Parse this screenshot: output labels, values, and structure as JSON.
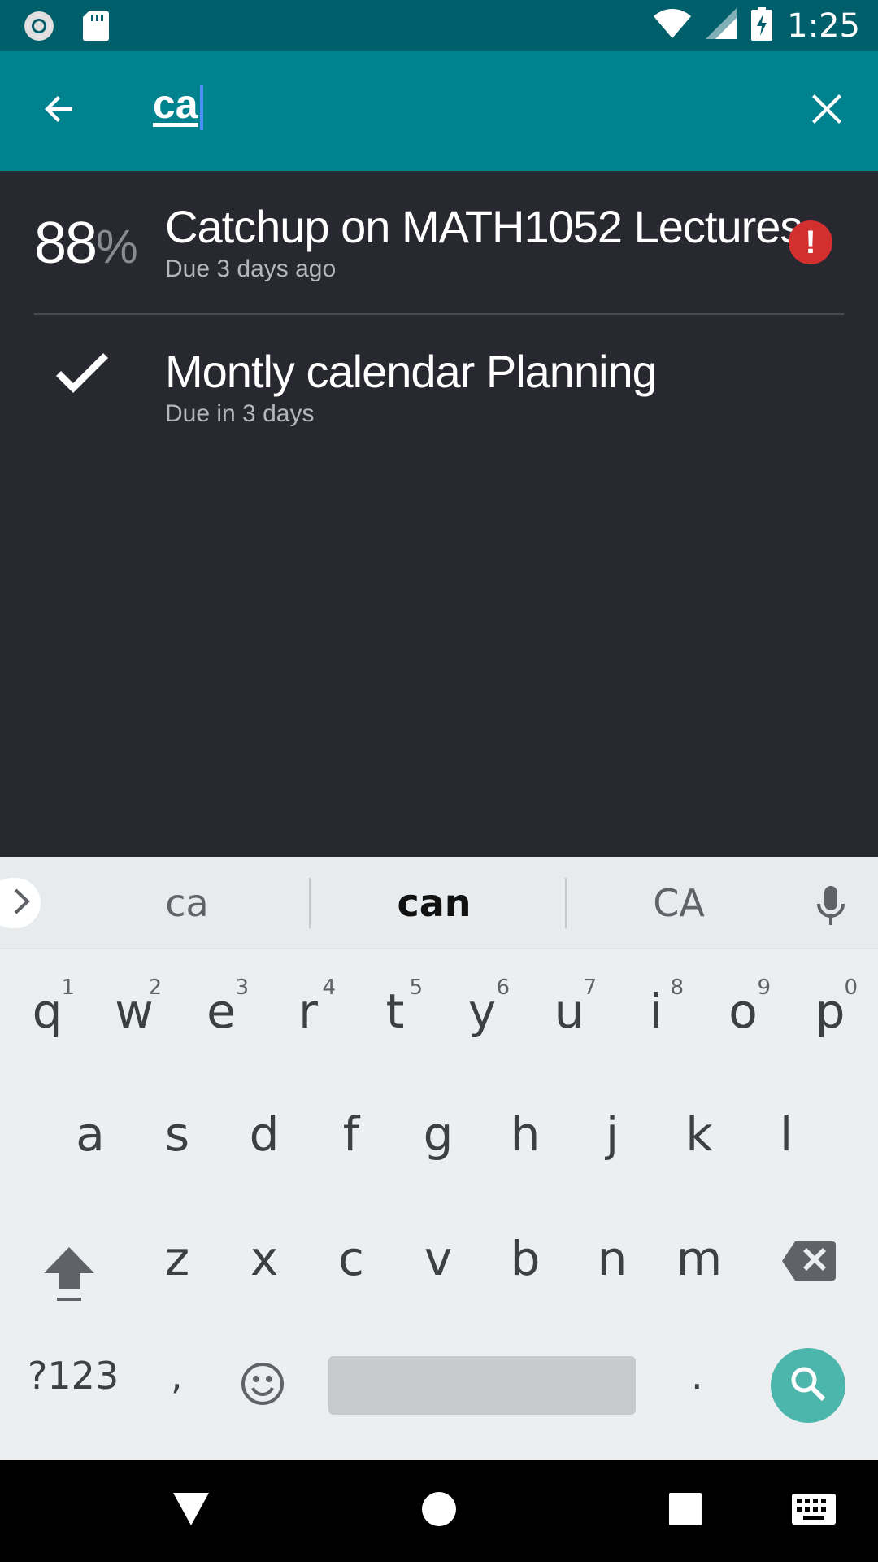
{
  "status_bar": {
    "time": "1:25",
    "icons": [
      "record-icon",
      "sd-card-icon",
      "wifi-icon",
      "cell-signal-icon",
      "battery-charging-icon"
    ]
  },
  "toolbar": {
    "search_query": "ca",
    "back_icon": "arrow-back-icon",
    "clear_icon": "close-icon"
  },
  "tasks": [
    {
      "progress_value": "88",
      "progress_unit": "%",
      "title": "Catchup on MATH1052 Lectures",
      "due": "Due 3 days ago",
      "status_icon": "overdue-alert-icon"
    },
    {
      "title": "Montly calendar Planning",
      "due": "Due in 3 days",
      "status_icon": "completed-check-icon"
    }
  ],
  "keyboard": {
    "suggestions": [
      "ca",
      "can",
      "CA"
    ],
    "row1": [
      {
        "key": "q",
        "hint": "1"
      },
      {
        "key": "w",
        "hint": "2"
      },
      {
        "key": "e",
        "hint": "3"
      },
      {
        "key": "r",
        "hint": "4"
      },
      {
        "key": "t",
        "hint": "5"
      },
      {
        "key": "y",
        "hint": "6"
      },
      {
        "key": "u",
        "hint": "7"
      },
      {
        "key": "i",
        "hint": "8"
      },
      {
        "key": "o",
        "hint": "9"
      },
      {
        "key": "p",
        "hint": "0"
      }
    ],
    "row2": [
      "a",
      "s",
      "d",
      "f",
      "g",
      "h",
      "j",
      "k",
      "l"
    ],
    "row3": [
      "z",
      "x",
      "c",
      "v",
      "b",
      "n",
      "m"
    ],
    "symbols_key": "?123",
    "comma_key": ",",
    "period_key": ".",
    "accent_color": "#4db6ac"
  },
  "nav_bar": {
    "icons": [
      "back-triangle-icon",
      "home-circle-icon",
      "recents-square-icon",
      "keyboard-icon"
    ]
  },
  "colors": {
    "toolbar": "#00838f",
    "status_bar": "#005f6a",
    "background": "#272830",
    "alert": "#d32f2f"
  }
}
